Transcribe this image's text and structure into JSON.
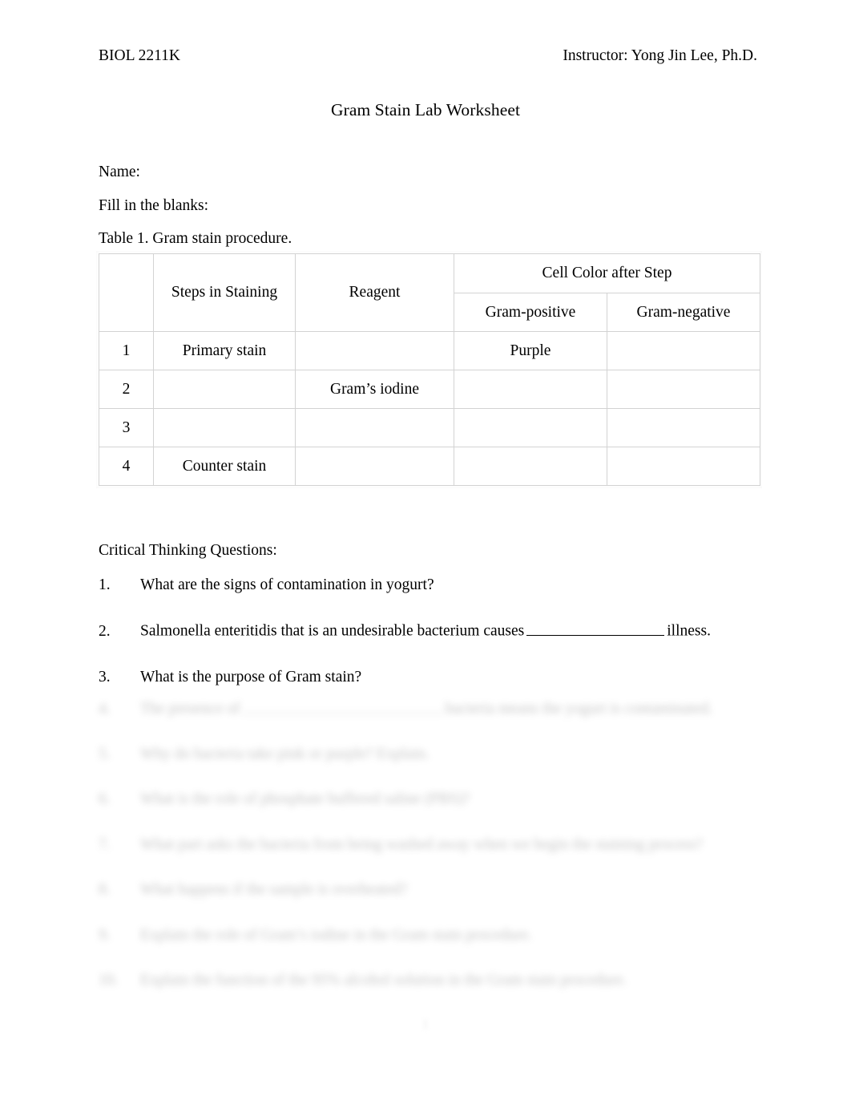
{
  "document": {
    "course_code": "BIOL 2211K",
    "instructor": "Instructor: Yong Jin Lee, Ph.D.",
    "title": "Gram Stain Lab Worksheet",
    "page_number": "1"
  },
  "intro": {
    "name_label": "Name:",
    "fill_in_label": "Fill in the blanks:",
    "table_caption": "Table 1. Gram stain procedure."
  },
  "table": {
    "headers": {
      "number": "",
      "steps": "Steps in Staining",
      "reagent": "Reagent",
      "cell_color_group": "Cell Color after Step",
      "gram_positive": "Gram-positive",
      "gram_negative": "Gram-negative"
    },
    "rows": [
      {
        "number": "1",
        "step": "Primary stain",
        "reagent": "",
        "gram_positive": "Purple",
        "gram_negative": ""
      },
      {
        "number": "2",
        "step": "",
        "reagent": "Gram’s iodine",
        "gram_positive": "",
        "gram_negative": ""
      },
      {
        "number": "3",
        "step": "",
        "reagent": "",
        "gram_positive": "",
        "gram_negative": ""
      },
      {
        "number": "4",
        "step": "Counter stain",
        "reagent": "",
        "gram_positive": "",
        "gram_negative": ""
      }
    ]
  },
  "questions": {
    "heading": "Critical Thinking Questions:",
    "visible": [
      {
        "number": "1.",
        "text_before": "What are the signs of contamination in yogurt?",
        "has_blank": false,
        "text_after": ""
      },
      {
        "number": "2.",
        "text_before": "Salmonella enteritidis that is an undesirable bacterium causes",
        "has_blank": true,
        "text_after": "illness."
      },
      {
        "number": "3.",
        "text_before": "What is the purpose of Gram stain?",
        "has_blank": false,
        "text_after": ""
      }
    ],
    "masked_note": "Questions 4–10 are obscured by a preview blur and are not legible.",
    "masked": [
      {
        "number": "4.",
        "text_before": "The presence of",
        "has_blank": true,
        "text_after": "bacteria means the yogurt is contaminated."
      },
      {
        "number": "5.",
        "text_before": "Why do bacteria take pink or purple? Explain.",
        "has_blank": false,
        "text_after": ""
      },
      {
        "number": "6.",
        "text_before": "What is the role of phosphate buffered saline (PBS)?",
        "has_blank": false,
        "text_after": ""
      },
      {
        "number": "7.",
        "text_before": "What part asks the bacteria from being washed away when we begin the staining process?",
        "has_blank": false,
        "text_after": ""
      },
      {
        "number": "8.",
        "text_before": "What happens if the sample is overheated?",
        "has_blank": false,
        "text_after": ""
      },
      {
        "number": "9.",
        "text_before": "Explain the role of Gram’s iodine in the Gram stain procedure.",
        "has_blank": false,
        "text_after": ""
      },
      {
        "number": "10.",
        "text_before": "Explain the function of the 95% alcohol solution in the Gram stain procedure.",
        "has_blank": false,
        "text_after": ""
      }
    ]
  }
}
